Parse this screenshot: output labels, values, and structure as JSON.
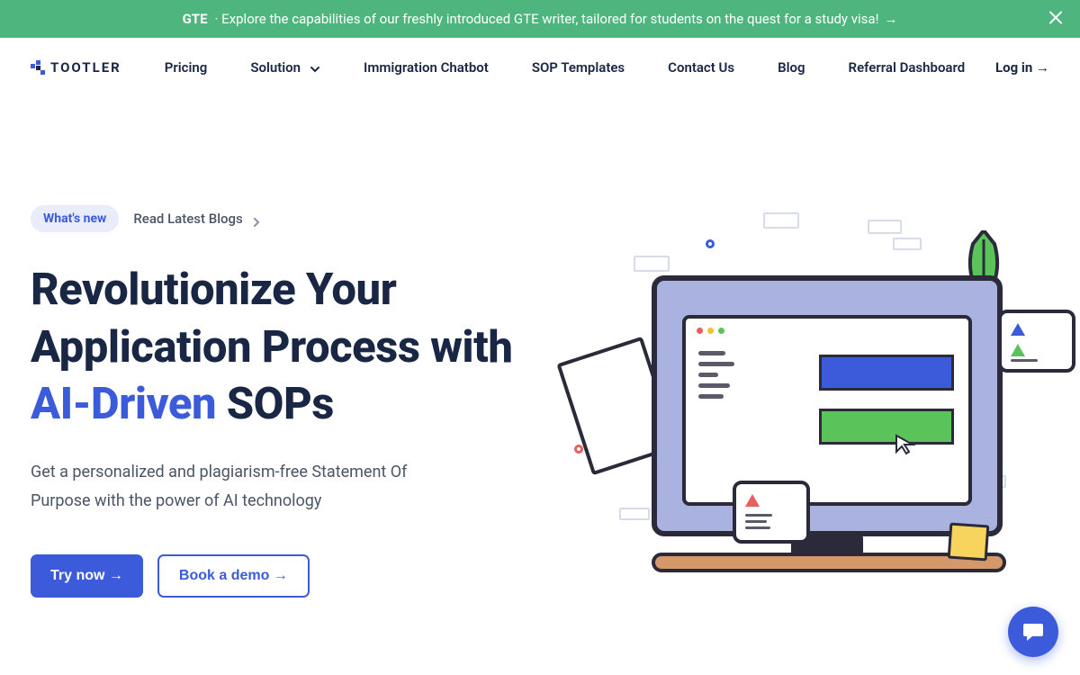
{
  "banner": {
    "badge": "GTE",
    "text": "Explore the capabilities of our freshly introduced GTE writer, tailored for students on the quest for a study visa!",
    "arrow": "→"
  },
  "brand": "TOOTLER",
  "nav": {
    "pricing": "Pricing",
    "solution": "Solution",
    "chatbot": "Immigration Chatbot",
    "templates": "SOP Templates",
    "contact": "Contact Us",
    "blog": "Blog",
    "referral": "Referral Dashboard",
    "login": "Log in →"
  },
  "hero": {
    "whats_new": "What's new",
    "read_blogs": "Read Latest Blogs",
    "headline_pre": "Revolutionize Your Application Process with ",
    "headline_highlight": "AI-Driven",
    "headline_post": " SOPs",
    "subhead": "Get a personalized and plagiarism-free Statement Of Purpose with the power of AI technology",
    "cta_primary": "Try now →",
    "cta_secondary": "Book a demo →"
  }
}
